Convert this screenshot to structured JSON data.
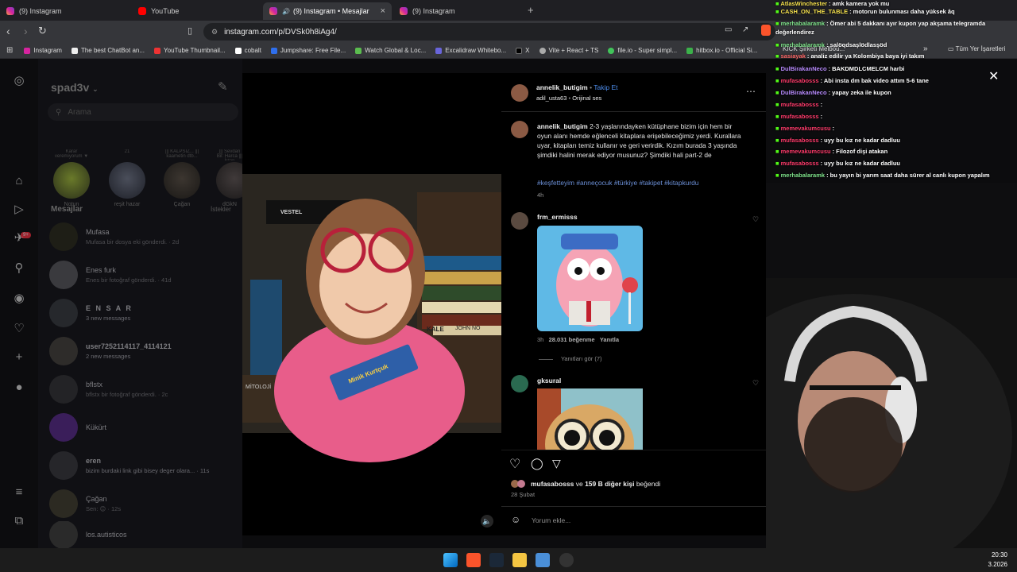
{
  "browser": {
    "tabs": [
      {
        "label": "(9) Instagram",
        "active": false
      },
      {
        "label": "YouTube",
        "active": false
      },
      {
        "label": "(9) Instagram • Mesajlar",
        "active": true
      },
      {
        "label": "(9) Instagram",
        "active": false
      }
    ],
    "new_tab": "+",
    "url": "instagram.com/p/DVSk0h8iAg4/",
    "bookmarks": [
      "Instagram",
      "The best ChatBot an...",
      "YouTube Thumbnail...",
      "cobalt",
      "Jumpshare: Free File...",
      "Watch Global & Loc...",
      "Excalidraw Whitebo...",
      "X",
      "Vite + React + TS",
      "file.io - Super simpl...",
      "hitbox.io - Official Si...",
      "KICK Şirketi Melbou..."
    ],
    "bookmarks_more": "»",
    "all_bookmarks": "Tüm Yer İşaretleri"
  },
  "dm": {
    "username": "spad3v",
    "search_placeholder": "Arama",
    "stories": [
      {
        "note": "Karar veremiyorum ▼",
        "name": "Notun"
      },
      {
        "note": "21",
        "name": "reşit hazar"
      },
      {
        "note": "||| KALPSİZ... ||| kaametin dtb...",
        "name": "Çağan"
      },
      {
        "note": "||| Sevdan Bil: Harca ||| İstan",
        "name": "dGkN"
      }
    ],
    "section_title": "Mesajlar",
    "requests_label": "İstekler",
    "conversations": [
      {
        "name": "Mufasa",
        "sub": "Mufasa bir dosya eki gönderdi. · 2d"
      },
      {
        "name": "Enes furk",
        "sub": "Enes bir fotoğraf gönderdi. · 41d"
      },
      {
        "name": "E N S A R",
        "sub": "3 new messages"
      },
      {
        "name": "user7252114117_4114121",
        "sub": "2 new messages"
      },
      {
        "name": "bflstx",
        "sub": "bflstx bir fotoğraf gönderdi. · 2c"
      },
      {
        "name": "Kükürt",
        "sub": ""
      },
      {
        "name": "eren",
        "sub": "bizim burdaki link gibi bisey deger olara... · 11s"
      },
      {
        "name": "Çağan",
        "sub": "Sen: 😊 · 12s"
      },
      {
        "name": "los.autisticos",
        "sub": ""
      }
    ],
    "badge": "9+"
  },
  "post": {
    "author": "annelik_butigim",
    "follow": "Takip Et",
    "bullet": "•",
    "audio_user": "adil_usta63",
    "audio_label": "Orijinal ses",
    "caption": "2-3 yaşlarındayken kütüphane bizim için hem bir oyun alanı hemde eğlenceli kitaplara erişebileceğimiz yerdi. Kurallara uyar, kitapları temiz kullanır ve geri verirdik. Kızım burada 3 yaşında şimdiki halini merak ediyor musunuz? Şimdiki hali part-2 de",
    "hashtags": "#keşfetteyim #anneçocuk #türkiye #takipet #kitapkurdu",
    "caption_time": "4h",
    "comments": [
      {
        "user": "frm_ermisss",
        "time": "3h",
        "likes": "28.031 beğenme",
        "reply": "Yanıtla",
        "view_replies": "Yanıtları gör (7)"
      },
      {
        "user": "gksural"
      }
    ],
    "likes_user": "mufasabosss",
    "likes_connector": "ve",
    "likes_others": "159 B diğer kişi",
    "likes_suffix": "beğendi",
    "date": "28 Şubat",
    "comment_placeholder": "Yorum ekle...",
    "book_text": "Minik Kurtçuk",
    "book_spine_1": "KALE",
    "book_spine_2": "JOHN NO",
    "book_spine_3": "MİTOLOJİ",
    "tv_brand": "VESTEL"
  },
  "chat": [
    {
      "user": "AtlasWinchester",
      "color": "#f4e04d",
      "msg": ": amk kamera yok mu"
    },
    {
      "user": "CASH_ON_THE_TABLE",
      "color": "#f4e04d",
      "msg": ": motorun bulunması daha yüksek âq"
    },
    {
      "user": "merhabalaramk",
      "color": "#7fe38b",
      "msg": ": Ömer abi 5 dakkanı ayır kupon yap akşama telegramda değerlendirez"
    },
    {
      "user": "merhabalaramk",
      "color": "#7fe38b",
      "msg": ": salöqdsaşlödlasşöd"
    },
    {
      "user": "sasiayak",
      "color": "#ff6a6a",
      "msg": ": analiz edilir ya Kolombiya baya iyi takım"
    },
    {
      "user": "DulBirakanNeco",
      "color": "#b98cff",
      "msg": ": BAKDMDLCMELCM harbi"
    },
    {
      "user": "mufasabosss",
      "color": "#ff3b6b",
      "msg": ": Abi insta dm bak video attım 5-6 tane"
    },
    {
      "user": "DulBirakanNeco",
      "color": "#b98cff",
      "msg": ": yapay zeka ile kupon"
    },
    {
      "user": "mufasabosss",
      "color": "#ff3b6b",
      "msg": ":"
    },
    {
      "user": "mufasabosss",
      "color": "#ff3b6b",
      "msg": ":"
    },
    {
      "user": "memevakumcusu",
      "color": "#ff3b6b",
      "msg": ":"
    },
    {
      "user": "mufasabosss",
      "color": "#ff3b6b",
      "msg": ": uyy bu kız ne kadar dadluu"
    },
    {
      "user": "memevakumcusu",
      "color": "#ff3b6b",
      "msg": ": Filozof dişi atakan"
    },
    {
      "user": "mufasabosss",
      "color": "#ff3b6b",
      "msg": ": uyy bu kız ne kadar dadluu"
    },
    {
      "user": "merhabalaramk",
      "color": "#7fe38b",
      "msg": ": bu yayın bi yarım saat daha sürer al canlı kupon yapalım"
    }
  ],
  "taskbar": {
    "time": "20:30",
    "date": "3.2026"
  },
  "colors": {
    "accent_blue": "#6b8fd6",
    "instagram_bg": "#0c0c0e",
    "chat_yellow": "#f4e04d",
    "chat_green": "#7fe38b",
    "chat_red": "#ff3b6b",
    "chat_purple": "#b98cff"
  }
}
